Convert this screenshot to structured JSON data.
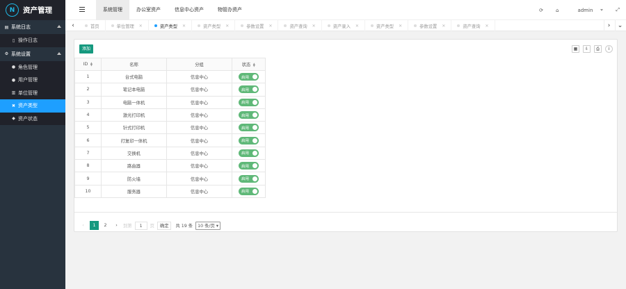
{
  "app": {
    "title": "资产管理"
  },
  "sidebar": {
    "groups": [
      {
        "label": "系统日志",
        "items": [
          {
            "label": "操作日志"
          }
        ]
      },
      {
        "label": "系统设置",
        "items": [
          {
            "label": "角色管理"
          },
          {
            "label": "用户管理"
          },
          {
            "label": "单位管理"
          },
          {
            "label": "资产类型",
            "active": true
          },
          {
            "label": "资产状态"
          }
        ]
      }
    ]
  },
  "header": {
    "nav": [
      "系统管理",
      "办公室资产",
      "信息中心资产",
      "物管办资产"
    ],
    "active_nav": 0,
    "user": "admin"
  },
  "tabs": [
    {
      "label": "首页",
      "closable": false
    },
    {
      "label": "单位管理",
      "closable": true
    },
    {
      "label": "资产类型",
      "closable": true,
      "active": true
    },
    {
      "label": "资产类型",
      "closable": true
    },
    {
      "label": "参数设置",
      "closable": true
    },
    {
      "label": "资产查询",
      "closable": true
    },
    {
      "label": "资产录入",
      "closable": true
    },
    {
      "label": "资产类型",
      "closable": true
    },
    {
      "label": "参数设置",
      "closable": true
    },
    {
      "label": "资产查询",
      "closable": true
    }
  ],
  "toolbar": {
    "add_label": "添加"
  },
  "table": {
    "headers": {
      "id": "ID",
      "name": "名称",
      "group": "分组",
      "state": "状态"
    },
    "rows": [
      {
        "id": "1",
        "name": "台式电脑",
        "group": "信息中心",
        "state": "启用"
      },
      {
        "id": "2",
        "name": "笔记本电脑",
        "group": "信息中心",
        "state": "启用"
      },
      {
        "id": "3",
        "name": "电脑一体机",
        "group": "信息中心",
        "state": "启用"
      },
      {
        "id": "4",
        "name": "激光打印机",
        "group": "信息中心",
        "state": "启用"
      },
      {
        "id": "5",
        "name": "针式打印机",
        "group": "信息中心",
        "state": "启用"
      },
      {
        "id": "6",
        "name": "打复印一体机",
        "group": "信息中心",
        "state": "启用"
      },
      {
        "id": "7",
        "name": "交换机",
        "group": "信息中心",
        "state": "启用"
      },
      {
        "id": "8",
        "name": "路由器",
        "group": "信息中心",
        "state": "启用"
      },
      {
        "id": "9",
        "name": "防火墙",
        "group": "信息中心",
        "state": "启用"
      },
      {
        "id": "10",
        "name": "服务器",
        "group": "信息中心",
        "state": "启用"
      }
    ]
  },
  "pagination": {
    "pages": [
      "1",
      "2"
    ],
    "current": "1",
    "goto_label": "到第",
    "goto_value": "1",
    "page_unit": "页",
    "confirm_label": "确定",
    "total_label": "共 19 条",
    "page_size_label": "10 条/页"
  },
  "colors": {
    "accent": "#16997f",
    "sidebar_active": "#1e9fff",
    "switch_on": "#5fb878"
  }
}
